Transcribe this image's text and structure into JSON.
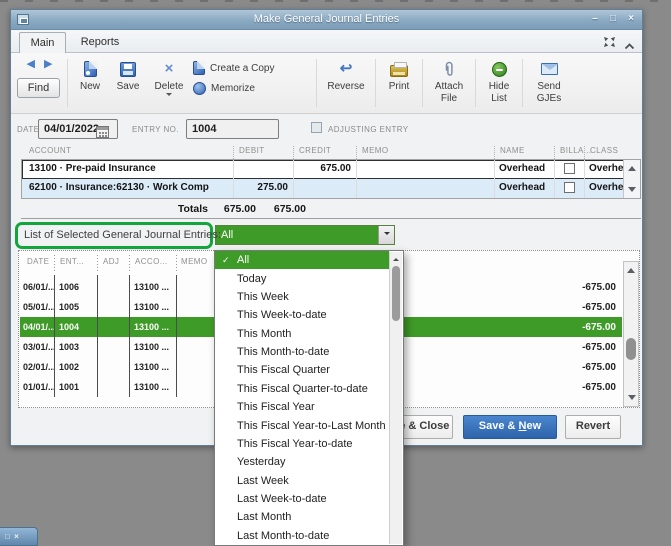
{
  "desktop": {
    "mini_restore": "□",
    "mini_close": "×"
  },
  "window": {
    "title": "Make General Journal Entries",
    "controls": {
      "minimize": "–",
      "maximize": "□",
      "close": "×"
    }
  },
  "tabs": {
    "main": "Main",
    "reports": "Reports"
  },
  "toolbar": {
    "find": "Find",
    "new": "New",
    "save": "Save",
    "delete": "Delete",
    "create_a_copy": "Create a Copy",
    "memorize": "Memorize",
    "reverse": "Reverse",
    "print": "Print",
    "attach_file": [
      "Attach",
      "File"
    ],
    "hide_list": [
      "Hide",
      "List"
    ],
    "send_gjes": [
      "Send",
      "GJEs"
    ]
  },
  "form": {
    "date_label": "DATE",
    "date_value": "04/01/2022",
    "entry_no_label": "ENTRY NO.",
    "entry_no_value": "1004",
    "adjusting_label": "ADJUSTING ENTRY"
  },
  "journal_table": {
    "headers": [
      "ACCOUNT",
      "DEBIT",
      "CREDIT",
      "MEMO",
      "NAME",
      "BILLA...",
      "CLASS"
    ],
    "rows": [
      {
        "account": "13100 · Pre-paid Insurance",
        "debit": "",
        "credit": "675.00",
        "memo": "",
        "name": "Overhead",
        "billable": false,
        "class": "Overhead"
      },
      {
        "account": "62100 · Insurance:62130 · Work Comp",
        "debit": "275.00",
        "credit": "",
        "memo": "",
        "name": "Overhead",
        "billable": false,
        "class": "Overhead"
      }
    ],
    "totals_label": "Totals",
    "totals_debit": "675.00",
    "totals_credit": "675.00"
  },
  "entries": {
    "label": "List of Selected General Journal Entries:",
    "headers": [
      "DATE",
      "ENT...",
      "ADJ",
      "ACCO...",
      "MEMO"
    ],
    "rows": [
      {
        "date": "06/01/...",
        "ent": "1006",
        "adj": "",
        "acco": "13100 ...",
        "amount": "-675.00"
      },
      {
        "date": "05/01/...",
        "ent": "1005",
        "adj": "",
        "acco": "13100 ...",
        "amount": "-675.00"
      },
      {
        "date": "04/01/...",
        "ent": "1004",
        "adj": "",
        "acco": "13100 ...",
        "amount": "-675.00"
      },
      {
        "date": "03/01/...",
        "ent": "1003",
        "adj": "",
        "acco": "13100 ...",
        "amount": "-675.00"
      },
      {
        "date": "02/01/...",
        "ent": "1002",
        "adj": "",
        "acco": "13100 ...",
        "amount": "-675.00"
      },
      {
        "date": "01/01/...",
        "ent": "1001",
        "adj": "",
        "acco": "13100 ...",
        "amount": "-675.00"
      }
    ],
    "selected_entry": "1004"
  },
  "dropdown": {
    "selected": "All",
    "items": [
      "All",
      "Today",
      "This Week",
      "This Week-to-date",
      "This Month",
      "This Month-to-date",
      "This Fiscal Quarter",
      "This Fiscal Quarter-to-date",
      "This Fiscal Year",
      "This Fiscal Year-to-Last Month",
      "This Fiscal Year-to-date",
      "Yesterday",
      "Last Week",
      "Last Week-to-date",
      "Last Month",
      "Last Month-to-date"
    ]
  },
  "buttons": {
    "save_close": "Save & Close",
    "save_new_pre": "Save & ",
    "save_new_underline": "N",
    "save_new_rest": "ew",
    "revert": "Revert"
  },
  "icons": {
    "check": "✓",
    "find_prev": "◀",
    "find_next": "▶",
    "reverse_arrow": "↩",
    "delete_x": "×"
  },
  "colors": {
    "qb_green": "#3f9b28",
    "annotation_green": "#12a63c",
    "accent_blue": "#3d77c2",
    "save_new_blue": "#3470bd",
    "row_highlight_blue": "#dcebf8"
  }
}
